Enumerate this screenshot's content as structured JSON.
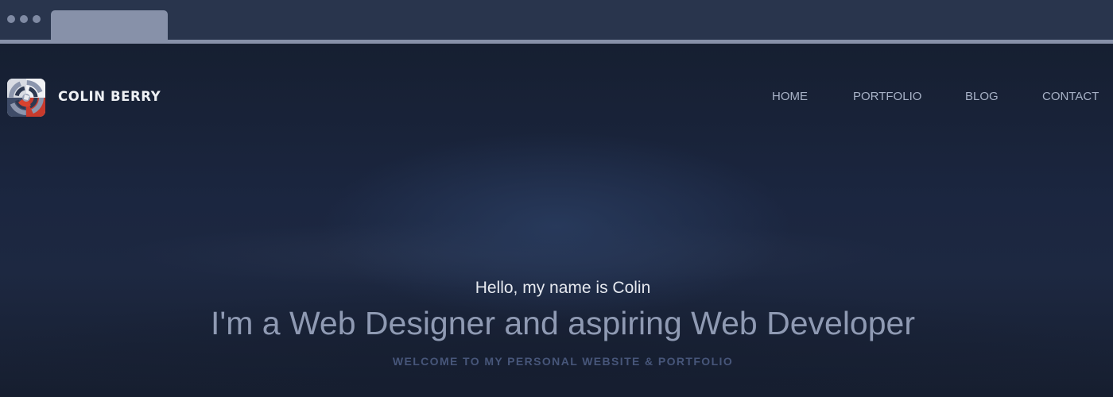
{
  "browser": {
    "tab_label": ""
  },
  "header": {
    "brand_name": "COLIN BERRY",
    "logo_icon": "spiral-logo-icon"
  },
  "nav": {
    "items": [
      {
        "label": "HOME"
      },
      {
        "label": "PORTFOLIO"
      },
      {
        "label": "BLOG"
      },
      {
        "label": "CONTACT"
      }
    ]
  },
  "hero": {
    "greeting": "Hello, my name is Colin",
    "title": "I'm a Web Designer and aspiring Web Developer",
    "subtitle": "WELCOME TO MY PERSONAL WEBSITE & PORTFOLIO"
  },
  "colors": {
    "background": "#1a2335",
    "chrome": "#29354d",
    "chrome_tab": "#8791a9",
    "logo_red": "#c83a2c",
    "nav_text": "#a8b2c7",
    "title_text": "#8f9ab3",
    "subtitle_text": "#47567a"
  }
}
